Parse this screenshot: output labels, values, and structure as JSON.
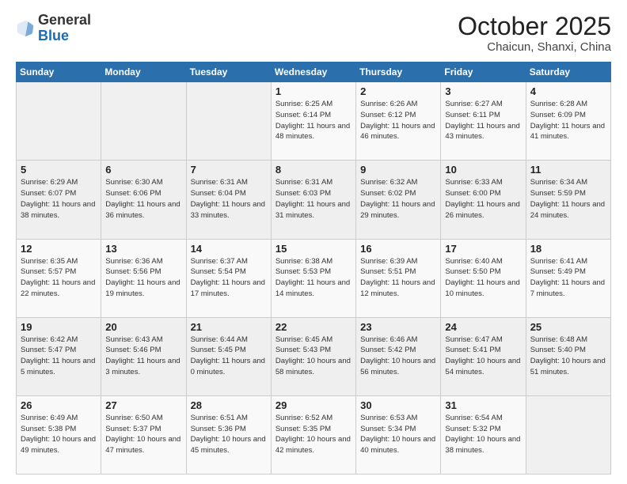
{
  "header": {
    "logo_general": "General",
    "logo_blue": "Blue",
    "month": "October 2025",
    "location": "Chaicun, Shanxi, China"
  },
  "weekdays": [
    "Sunday",
    "Monday",
    "Tuesday",
    "Wednesday",
    "Thursday",
    "Friday",
    "Saturday"
  ],
  "weeks": [
    [
      {
        "day": "",
        "info": ""
      },
      {
        "day": "",
        "info": ""
      },
      {
        "day": "",
        "info": ""
      },
      {
        "day": "1",
        "info": "Sunrise: 6:25 AM\nSunset: 6:14 PM\nDaylight: 11 hours\nand 48 minutes."
      },
      {
        "day": "2",
        "info": "Sunrise: 6:26 AM\nSunset: 6:12 PM\nDaylight: 11 hours\nand 46 minutes."
      },
      {
        "day": "3",
        "info": "Sunrise: 6:27 AM\nSunset: 6:11 PM\nDaylight: 11 hours\nand 43 minutes."
      },
      {
        "day": "4",
        "info": "Sunrise: 6:28 AM\nSunset: 6:09 PM\nDaylight: 11 hours\nand 41 minutes."
      }
    ],
    [
      {
        "day": "5",
        "info": "Sunrise: 6:29 AM\nSunset: 6:07 PM\nDaylight: 11 hours\nand 38 minutes."
      },
      {
        "day": "6",
        "info": "Sunrise: 6:30 AM\nSunset: 6:06 PM\nDaylight: 11 hours\nand 36 minutes."
      },
      {
        "day": "7",
        "info": "Sunrise: 6:31 AM\nSunset: 6:04 PM\nDaylight: 11 hours\nand 33 minutes."
      },
      {
        "day": "8",
        "info": "Sunrise: 6:31 AM\nSunset: 6:03 PM\nDaylight: 11 hours\nand 31 minutes."
      },
      {
        "day": "9",
        "info": "Sunrise: 6:32 AM\nSunset: 6:02 PM\nDaylight: 11 hours\nand 29 minutes."
      },
      {
        "day": "10",
        "info": "Sunrise: 6:33 AM\nSunset: 6:00 PM\nDaylight: 11 hours\nand 26 minutes."
      },
      {
        "day": "11",
        "info": "Sunrise: 6:34 AM\nSunset: 5:59 PM\nDaylight: 11 hours\nand 24 minutes."
      }
    ],
    [
      {
        "day": "12",
        "info": "Sunrise: 6:35 AM\nSunset: 5:57 PM\nDaylight: 11 hours\nand 22 minutes."
      },
      {
        "day": "13",
        "info": "Sunrise: 6:36 AM\nSunset: 5:56 PM\nDaylight: 11 hours\nand 19 minutes."
      },
      {
        "day": "14",
        "info": "Sunrise: 6:37 AM\nSunset: 5:54 PM\nDaylight: 11 hours\nand 17 minutes."
      },
      {
        "day": "15",
        "info": "Sunrise: 6:38 AM\nSunset: 5:53 PM\nDaylight: 11 hours\nand 14 minutes."
      },
      {
        "day": "16",
        "info": "Sunrise: 6:39 AM\nSunset: 5:51 PM\nDaylight: 11 hours\nand 12 minutes."
      },
      {
        "day": "17",
        "info": "Sunrise: 6:40 AM\nSunset: 5:50 PM\nDaylight: 11 hours\nand 10 minutes."
      },
      {
        "day": "18",
        "info": "Sunrise: 6:41 AM\nSunset: 5:49 PM\nDaylight: 11 hours\nand 7 minutes."
      }
    ],
    [
      {
        "day": "19",
        "info": "Sunrise: 6:42 AM\nSunset: 5:47 PM\nDaylight: 11 hours\nand 5 minutes."
      },
      {
        "day": "20",
        "info": "Sunrise: 6:43 AM\nSunset: 5:46 PM\nDaylight: 11 hours\nand 3 minutes."
      },
      {
        "day": "21",
        "info": "Sunrise: 6:44 AM\nSunset: 5:45 PM\nDaylight: 11 hours\nand 0 minutes."
      },
      {
        "day": "22",
        "info": "Sunrise: 6:45 AM\nSunset: 5:43 PM\nDaylight: 10 hours\nand 58 minutes."
      },
      {
        "day": "23",
        "info": "Sunrise: 6:46 AM\nSunset: 5:42 PM\nDaylight: 10 hours\nand 56 minutes."
      },
      {
        "day": "24",
        "info": "Sunrise: 6:47 AM\nSunset: 5:41 PM\nDaylight: 10 hours\nand 54 minutes."
      },
      {
        "day": "25",
        "info": "Sunrise: 6:48 AM\nSunset: 5:40 PM\nDaylight: 10 hours\nand 51 minutes."
      }
    ],
    [
      {
        "day": "26",
        "info": "Sunrise: 6:49 AM\nSunset: 5:38 PM\nDaylight: 10 hours\nand 49 minutes."
      },
      {
        "day": "27",
        "info": "Sunrise: 6:50 AM\nSunset: 5:37 PM\nDaylight: 10 hours\nand 47 minutes."
      },
      {
        "day": "28",
        "info": "Sunrise: 6:51 AM\nSunset: 5:36 PM\nDaylight: 10 hours\nand 45 minutes."
      },
      {
        "day": "29",
        "info": "Sunrise: 6:52 AM\nSunset: 5:35 PM\nDaylight: 10 hours\nand 42 minutes."
      },
      {
        "day": "30",
        "info": "Sunrise: 6:53 AM\nSunset: 5:34 PM\nDaylight: 10 hours\nand 40 minutes."
      },
      {
        "day": "31",
        "info": "Sunrise: 6:54 AM\nSunset: 5:32 PM\nDaylight: 10 hours\nand 38 minutes."
      },
      {
        "day": "",
        "info": ""
      }
    ]
  ]
}
